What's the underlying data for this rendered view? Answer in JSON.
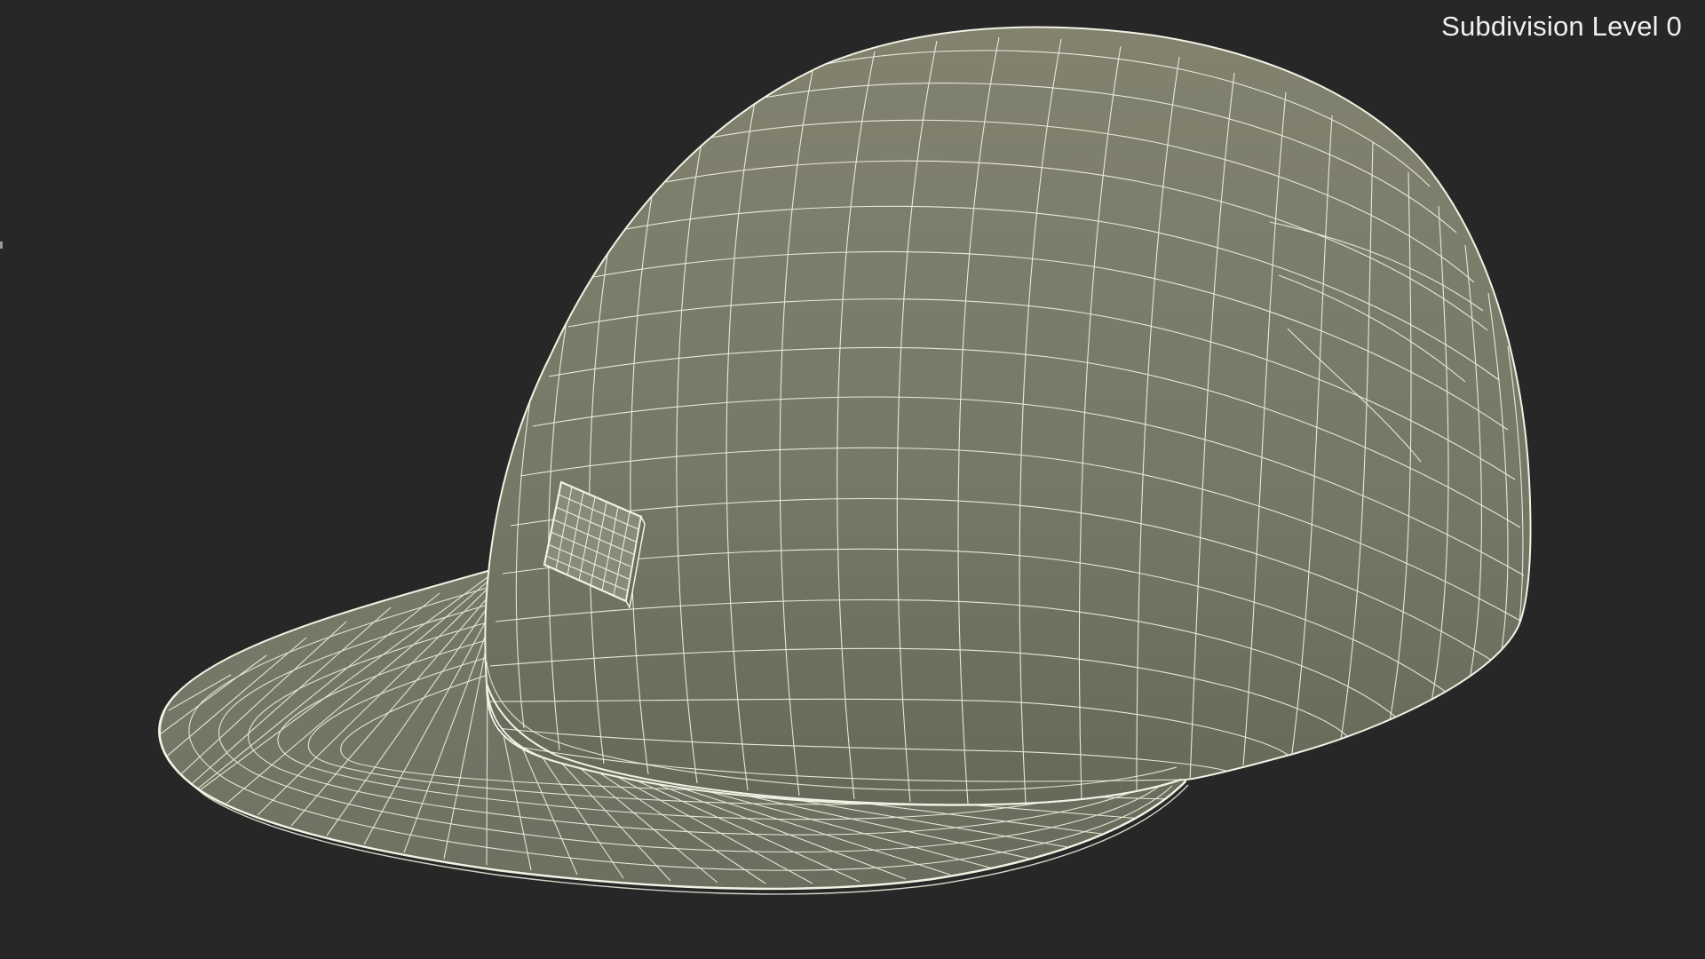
{
  "viewport": {
    "label": "Subdivision Level 0",
    "background_color": "#272727"
  },
  "model": {
    "name": "cap-wireframe",
    "surface_color": "#7a7a6c",
    "wire_color": "#f2f2e4"
  }
}
